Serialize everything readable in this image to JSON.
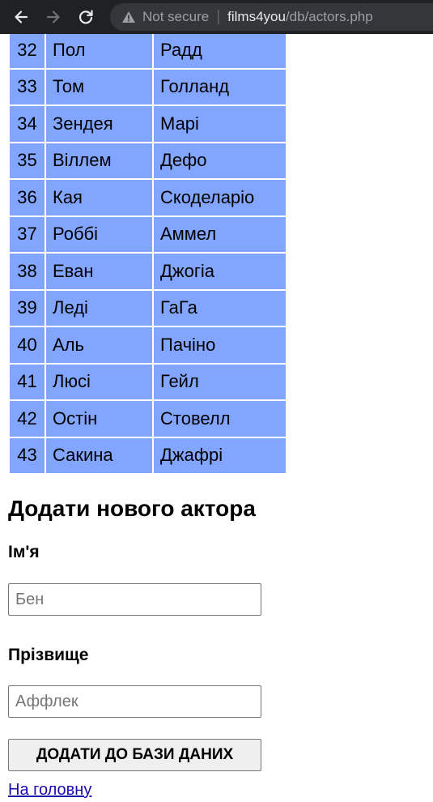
{
  "browser": {
    "security_status": "Not secure",
    "url_host": "films4you",
    "url_path": "/db/actors.php"
  },
  "actors": [
    {
      "id": "32",
      "first_name": "Пол",
      "last_name": "Радд"
    },
    {
      "id": "33",
      "first_name": "Том",
      "last_name": "Голланд"
    },
    {
      "id": "34",
      "first_name": "Зендея",
      "last_name": "Марі"
    },
    {
      "id": "35",
      "first_name": "Віллем",
      "last_name": "Дефо"
    },
    {
      "id": "36",
      "first_name": "Кая",
      "last_name": "Скоделаріо"
    },
    {
      "id": "37",
      "first_name": "Роббі",
      "last_name": "Аммел"
    },
    {
      "id": "38",
      "first_name": "Еван",
      "last_name": "Джогіа"
    },
    {
      "id": "39",
      "first_name": "Леді",
      "last_name": "ГаГа"
    },
    {
      "id": "40",
      "first_name": "Аль",
      "last_name": "Пачіно"
    },
    {
      "id": "41",
      "first_name": "Люсі",
      "last_name": "Гейл"
    },
    {
      "id": "42",
      "first_name": "Остін",
      "last_name": "Стовелл"
    },
    {
      "id": "43",
      "first_name": "Сакина",
      "last_name": "Джафрі"
    }
  ],
  "form": {
    "title": "Додати нового актора",
    "first_name_label": "Ім'я",
    "first_name_placeholder": "Бен",
    "first_name_value": "",
    "last_name_label": "Прізвище",
    "last_name_placeholder": "Аффлек",
    "last_name_value": "",
    "submit_label": "ДОДАТИ ДО БАЗИ ДАНИХ"
  },
  "home_link": "На головну",
  "colors": {
    "table_cell_bg": "#82a6ff",
    "chrome_bg": "#202124",
    "link": "#1a0dab"
  }
}
